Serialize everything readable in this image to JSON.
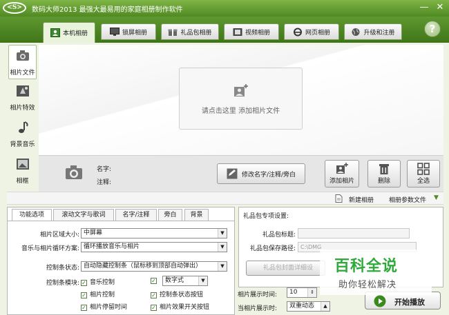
{
  "titlebar": {
    "logo_text": "<S>",
    "title": "数码大师2013  最强大最易用的家庭相册制作软件",
    "minimize": "—",
    "close": "✕"
  },
  "tabs": [
    {
      "label": "本机相册",
      "icon": "photo-album-icon",
      "active": true
    },
    {
      "label": "锁屏相册",
      "icon": "monitor-icon"
    },
    {
      "label": "礼品包相册",
      "icon": "gift-icon"
    },
    {
      "label": "视频相册",
      "icon": "film-icon"
    },
    {
      "label": "网页相册",
      "icon": "ie-browser-icon"
    },
    {
      "label": "升级和注册",
      "icon": "globe-icon"
    }
  ],
  "help_label": "?",
  "sidebar": [
    {
      "label": "相片文件",
      "icon": "camera-icon"
    },
    {
      "label": "相片特效",
      "icon": "effects-icon"
    },
    {
      "label": "背景音乐",
      "icon": "music-note-icon"
    },
    {
      "label": "相框",
      "icon": "picture-frame-icon"
    }
  ],
  "canvas": {
    "add_prompt": "请点击这里  添加相片文件"
  },
  "info": {
    "name_label": "名字:",
    "note_label": "注释:",
    "edit_button": "修改名字/注释/旁白"
  },
  "photo_actions": {
    "add": "添加相片",
    "delete": "删除",
    "select_all": "全选"
  },
  "actionbar": {
    "new_album": "新建相册",
    "params": "相册参数文件"
  },
  "options": {
    "tabs": [
      "功能选项",
      "滚动文字与歌词",
      "名字/注释",
      "旁白",
      "背景"
    ],
    "area_size_label": "相片区域大小:",
    "area_size_value": "中屏幕",
    "loop_label": "音乐与相片循环方案:",
    "loop_value": "循环播放音乐与相片",
    "ctrlbar_state_label": "控制条状态:",
    "ctrlbar_state_value": "自动隐藏控制条（鼠标移到顶部自动弹出）",
    "ctrlbar_modules_label": "控制条模块:",
    "checkboxes": [
      "音乐控制",
      "相片控制",
      "相片停留时间",
      "控制条状态按钮",
      "相片效果开关按钮"
    ],
    "digit_value": "数字式"
  },
  "gift": {
    "section_title": "礼品包专项设置:",
    "title_label": "礼品包标题:",
    "path_label": "礼品包保存路径:",
    "path_value": "C:\\DMG",
    "cover_button": "礼品包封面详细设",
    "show_time_label": "相片展示时间:",
    "show_time_value": "10",
    "show_mode_label": "当相片展示时:",
    "show_mode_value": "双重动态"
  },
  "play_button": "开始播放",
  "watermark": {
    "big": "百科全说",
    "small": "助你轻松解决"
  }
}
